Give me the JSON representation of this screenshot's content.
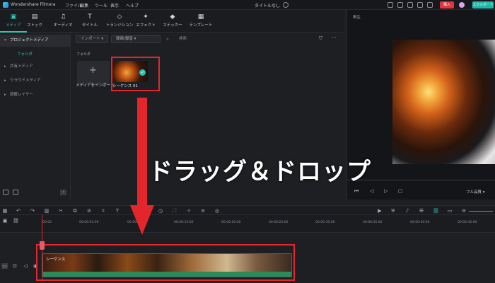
{
  "window": {
    "app_title": "Wondershare Filmora",
    "menu": [
      "ファイル",
      "編集",
      "ツール",
      "表示",
      "ヘルプ"
    ],
    "project_title": "タイトルなし",
    "buy_label": "購入",
    "export_label": "エクスポート"
  },
  "toolbar": {
    "tabs": [
      {
        "label": "メディア",
        "icon": "media-icon",
        "glyph": "▣"
      },
      {
        "label": "ストック",
        "icon": "stock-icon",
        "glyph": "▤"
      },
      {
        "label": "オーディオ",
        "icon": "music-note-icon",
        "glyph": "♫"
      },
      {
        "label": "タイトル",
        "icon": "title-text-icon",
        "glyph": "T"
      },
      {
        "label": "トランジション",
        "icon": "transition-icon",
        "glyph": "◇"
      },
      {
        "label": "エフェクト",
        "icon": "effect-icon",
        "glyph": "✦"
      },
      {
        "label": "ステッカー",
        "icon": "sticker-icon",
        "glyph": "◆"
      },
      {
        "label": "テンプレート",
        "icon": "template-icon",
        "glyph": "▦"
      }
    ]
  },
  "sidebar": {
    "items": [
      {
        "label": "プロジェクトメディア",
        "selected": true
      },
      {
        "label": "共有メディア"
      },
      {
        "label": "クラウドメディア"
      },
      {
        "label": "調整レイヤー"
      }
    ],
    "folder_label": "フォルダ"
  },
  "media": {
    "import_dropdown": "インポート",
    "record_dropdown": "録画/録音",
    "search_placeholder": "検索",
    "folder_heading": "フォルダ",
    "import_card_label": "メディアをインポート",
    "sequence_label": "シーケンス 01"
  },
  "preview": {
    "title": "再生",
    "quality": "フル品質"
  },
  "timeline": {
    "ruler_ticks": [
      "00:00",
      "00:00:05:00",
      "00:00:10:00",
      "00:00:15:00",
      "00:00:20:00",
      "00:00:25:00",
      "00:00:30:00",
      "00:00:35:00",
      "00:00:40:00",
      "00:00:45:00"
    ],
    "clip_label": "シーケンス"
  },
  "annotation": {
    "text": "ドラッグ＆ドロップ",
    "color": "#e3262b"
  }
}
